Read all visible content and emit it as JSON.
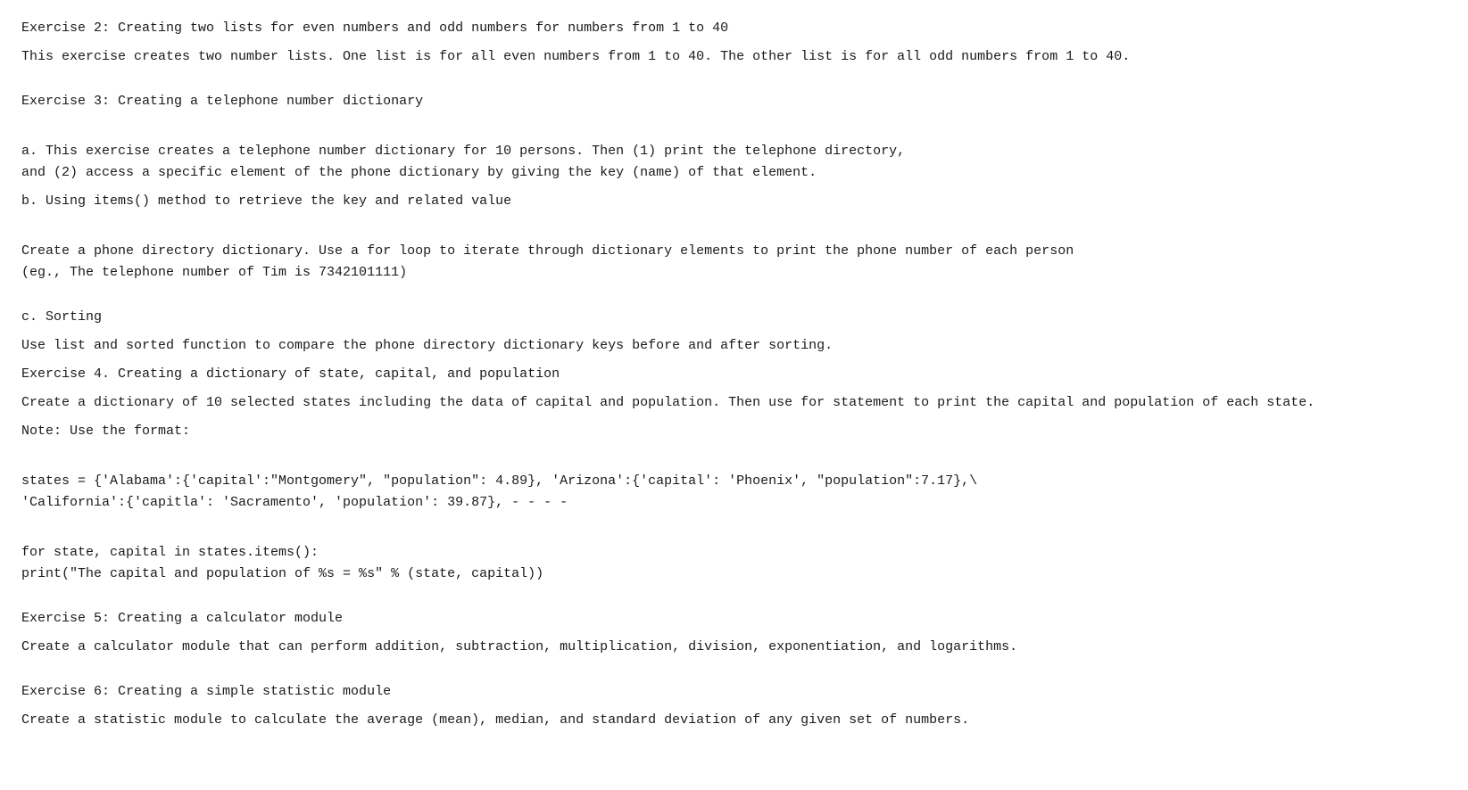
{
  "sections": [
    {
      "id": "ex2-title",
      "text": "Exercise 2:  Creating two lists for even numbers and odd numbers for numbers from 1 to 40"
    },
    {
      "id": "ex2-desc",
      "text": "This exercise creates two number lists. One list is for all even numbers from 1 to 40. The other list is for all odd numbers from 1 to 40."
    },
    {
      "id": "spacer1",
      "text": ""
    },
    {
      "id": "ex3-title",
      "text": "Exercise 3:  Creating a telephone number dictionary"
    },
    {
      "id": "ex3-desc-a",
      "text": "a. This exercise creates a telephone number dictionary for 10 persons. Then (1) print the telephone directory,\nand (2) access a specific element of the phone dictionary by giving the key (name) of that element."
    },
    {
      "id": "ex3-desc-b-title",
      "text": "b. Using items() method to retrieve the key and related value"
    },
    {
      "id": "ex3-desc-b-body",
      "text": "Create a phone directory dictionary. Use a for loop to iterate through dictionary elements to print the phone number of each person\n(eg., The telephone number of Tim is 7342101111)"
    },
    {
      "id": "spacer2",
      "text": ""
    },
    {
      "id": "ex3-desc-c-title",
      "text": "c. Sorting"
    },
    {
      "id": "ex3-desc-c-body",
      "text": "Use list and sorted function to compare the phone directory dictionary keys before and after sorting."
    },
    {
      "id": "ex4-title",
      "text": "Exercise 4.  Creating a dictionary of state, capital, and population"
    },
    {
      "id": "ex4-desc",
      "text": "Create a dictionary of 10 selected states including the data of capital and population. Then use for statement to print the capital and population of each state."
    },
    {
      "id": "ex4-note",
      "text": "Note: Use the format:"
    },
    {
      "id": "ex4-code",
      "text": "states = {'Alabama':{'capital':\"Montgomery\", \"population\": 4.89}, 'Arizona':{'capital': 'Phoenix', \"population\":7.17},\\\n        'California':{'capitla': 'Sacramento', 'population': 39.87}, - - - -"
    },
    {
      "id": "ex4-code2",
      "text": "for state, capital in states.items():\n    print(\"The capital and population of %s = %s\" % (state, capital))"
    },
    {
      "id": "spacer3",
      "text": ""
    },
    {
      "id": "ex5-title",
      "text": "Exercise 5:  Creating a calculator module"
    },
    {
      "id": "ex5-desc",
      "text": "Create a calculator module that can perform addition, subtraction, multiplication, division, exponentiation, and logarithms."
    },
    {
      "id": "spacer4",
      "text": ""
    },
    {
      "id": "ex6-title",
      "text": "Exercise 6:  Creating a simple statistic module"
    },
    {
      "id": "ex6-desc",
      "text": "Create a statistic module to calculate the average (mean), median, and standard deviation of any given set of numbers."
    }
  ]
}
